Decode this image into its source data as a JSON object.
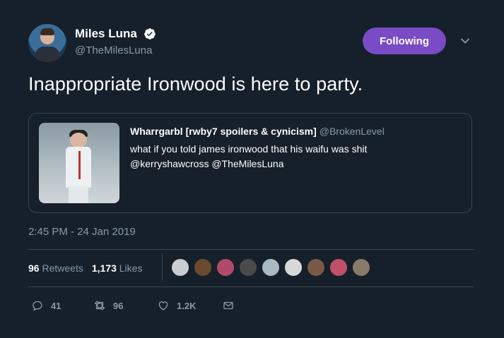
{
  "author": {
    "name": "Miles Luna",
    "handle": "@TheMilesLuna"
  },
  "follow_label": "Following",
  "tweet_text": "Inappropriate Ironwood is here to party.",
  "quoted": {
    "name": "Wharrgarbl [rwby7 spoilers & cynicism]",
    "handle": "@BrokenLevel",
    "line1": "what if you told james ironwood that his waifu was shit",
    "line2": "@kerryshawcross @TheMilesLuna"
  },
  "timestamp": "2:45 PM - 24 Jan 2019",
  "stats": {
    "retweets_count": "96",
    "retweets_label": "Retweets",
    "likes_count": "1,173",
    "likes_label": "Likes"
  },
  "likers": [
    {
      "color": "#c9cdd1"
    },
    {
      "color": "#6b4a2e"
    },
    {
      "color": "#b04a6a"
    },
    {
      "color": "#4a4a4a"
    },
    {
      "color": "#aab8c2"
    },
    {
      "color": "#d8d8d8"
    },
    {
      "color": "#7a5a46"
    },
    {
      "color": "#c0506a"
    },
    {
      "color": "#8a7a6a"
    }
  ],
  "actions": {
    "reply_count": "41",
    "retweet_count": "96",
    "like_count": "1.2K"
  },
  "colors": {
    "background": "#15202b",
    "accent": "#794bc4",
    "muted": "#8899a6",
    "border": "#38444d"
  }
}
